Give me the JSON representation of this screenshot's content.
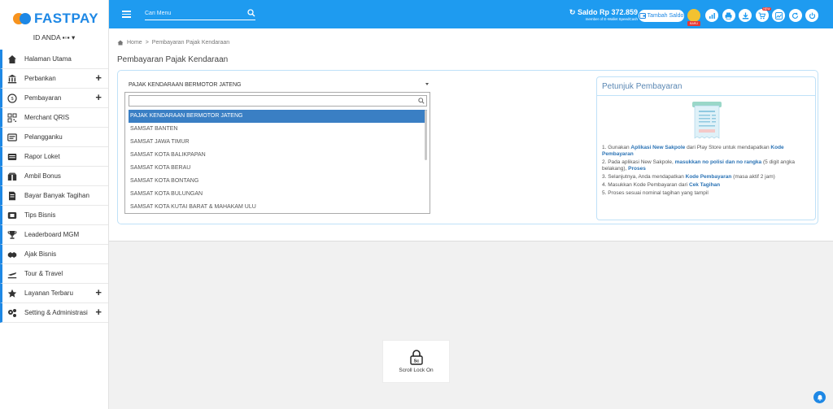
{
  "brand": {
    "name": "FASTPAY",
    "accent": "#1e9bf0",
    "orange": "#f7931e"
  },
  "user": {
    "id_label": "ID ANDA ▪▫▪ ▾"
  },
  "sidebar": {
    "items": [
      {
        "label": "Halaman Utama",
        "icon": "home-icon",
        "expandable": false
      },
      {
        "label": "Perbankan",
        "icon": "bank-icon",
        "expandable": true
      },
      {
        "label": "Pembayaran",
        "icon": "payment-icon",
        "expandable": true
      },
      {
        "label": "Merchant QRIS",
        "icon": "qr-icon",
        "expandable": false
      },
      {
        "label": "Pelangganku",
        "icon": "customer-card-icon",
        "expandable": false
      },
      {
        "label": "Rapor Loket",
        "icon": "report-icon",
        "expandable": false
      },
      {
        "label": "Ambil Bonus",
        "icon": "bonus-icon",
        "expandable": false
      },
      {
        "label": "Bayar Banyak Tagihan",
        "icon": "bill-icon",
        "expandable": false
      },
      {
        "label": "Tips Bisnis",
        "icon": "tips-icon",
        "expandable": false
      },
      {
        "label": "Leaderboard MGM",
        "icon": "trophy-icon",
        "expandable": false
      },
      {
        "label": "Ajak Bisnis",
        "icon": "handshake-icon",
        "expandable": false
      },
      {
        "label": "Tour & Travel",
        "icon": "plane-icon",
        "expandable": false
      },
      {
        "label": "Layanan Terbaru",
        "icon": "star-icon",
        "expandable": true
      },
      {
        "label": "Setting & Administrasi",
        "icon": "cogs-icon",
        "expandable": true
      }
    ],
    "plus": "+"
  },
  "topbar": {
    "search_placeholder": "Cari Menu",
    "saldo": "Saldo Rp 372.859",
    "saldo_sub": "member of E-Wallet",
    "saldo_sub2": "SpeedCash",
    "tambah_saldo": "Tambah Saldo",
    "baru": "BARU",
    "icon_badge": "NEW",
    "icons": [
      "chart-icon",
      "print-icon",
      "download-icon",
      "cart-icon",
      "line-chart-icon",
      "refresh-icon",
      "power-icon"
    ]
  },
  "breadcrumb": {
    "home": "Home",
    "sep": ">",
    "current": "Pembayaran Pajak Kendaraan"
  },
  "page_title": "Pembayaran Pajak Kendaraan",
  "select": {
    "value": "PAJAK KENDARAAN BERMOTOR JATENG",
    "search_value": "",
    "options": [
      "PAJAK KENDARAAN BERMOTOR JATENG",
      "SAMSAT BANTEN",
      "SAMSAT JAWA TIMUR",
      "SAMSAT KOTA BALIKPAPAN",
      "SAMSAT KOTA BERAU",
      "SAMSAT KOTA BONTANG",
      "SAMSAT KOTA BULUNGAN",
      "SAMSAT KOTA KUTAI BARAT & MAHAKAM ULU"
    ],
    "selected_index": 0
  },
  "petunjuk": {
    "title": "Petunjuk Pembayaran",
    "steps": [
      {
        "parts": [
          [
            "1. Gunakan ",
            false
          ],
          [
            "Aplikasi New Sakpole",
            true
          ],
          [
            " dari Play Store untuk mendapatkan ",
            false
          ],
          [
            "Kode Pembayaran",
            true
          ]
        ]
      },
      {
        "parts": [
          [
            "2. Pada aplikasi New Sakpole, ",
            false
          ],
          [
            "masukkan no polisi dan no rangka",
            true
          ],
          [
            " (5 digit angka belakang), ",
            false
          ],
          [
            "Proses",
            true
          ]
        ]
      },
      {
        "parts": [
          [
            "3. Selanjutnya, Anda mendapatkan ",
            false
          ],
          [
            "Kode Pembayaran",
            true
          ],
          [
            " (masa aktif 2 jam)",
            false
          ]
        ]
      },
      {
        "parts": [
          [
            "4. Masukkan Kode Pembayaran dari ",
            false
          ],
          [
            "Cek Tagihan",
            true
          ]
        ]
      },
      {
        "parts": [
          [
            "5. Proses sesuai nominal tagihan yang tampil",
            false
          ]
        ]
      }
    ]
  },
  "scroll_lock": {
    "label": "Scroll Lock On",
    "key": "Sc"
  }
}
